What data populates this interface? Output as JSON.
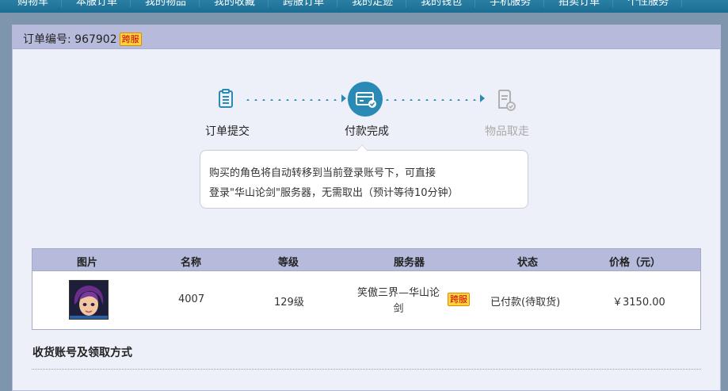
{
  "nav": {
    "items": [
      "购物车",
      "本服订单",
      "我的物品",
      "我的收藏",
      "跨服订单",
      "我的足迹",
      "我的钱包",
      "手机服务",
      "拍卖订单",
      "个性服务"
    ]
  },
  "order": {
    "label": "订单编号: 967902",
    "badge": "跨服"
  },
  "steps": [
    {
      "label": "订单提交",
      "icon": "document-list-icon",
      "state": "done"
    },
    {
      "label": "付款完成",
      "icon": "card-check-icon",
      "state": "current"
    },
    {
      "label": "物品取走",
      "icon": "document-check-icon",
      "state": "pending"
    }
  ],
  "tip": {
    "line1": "购买的角色将自动转移到当前登录账号下，可直接",
    "line2": "登录\"华山论剑\"服务器，无需取出（预计等待10分钟）"
  },
  "table": {
    "headers": [
      "图片",
      "名称",
      "等级",
      "服务器",
      "状态",
      "价格（元）"
    ],
    "row": {
      "name": "4007",
      "level": "129级",
      "server_line1": "笑傲三界—华山论",
      "server_line2": "剑",
      "server_badge": "跨服",
      "status": "已付款(待取货)",
      "price": "￥3150.00"
    }
  },
  "section": {
    "title": "收货账号及领取方式"
  },
  "colors": {
    "accent": "#2a8ab6",
    "header_bg": "#b6bbdc",
    "panel_bg": "#eef0f9",
    "badge_bg": "#ffd23e"
  }
}
